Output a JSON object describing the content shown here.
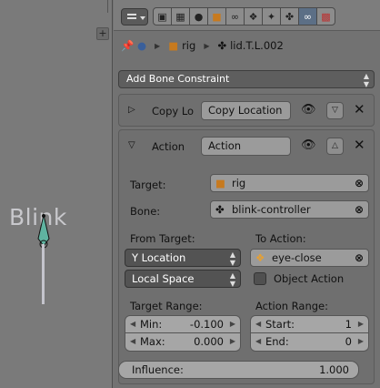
{
  "viewport": {
    "bone_name": "Blink"
  },
  "header": {
    "tabs": [
      "render-icon",
      "scene-icon",
      "world-icon",
      "object-icon",
      "constraint-icon",
      "modifier-icon",
      "data-icon",
      "bone-icon",
      "bone-constraint-icon",
      "texture-icon"
    ],
    "active_tab": "bone-constraint-icon"
  },
  "breadcrumb": {
    "object": "rig",
    "bone": "lid.T.L.002"
  },
  "add_constraint": {
    "label": "Add Bone Constraint"
  },
  "constraints": [
    {
      "type": "Copy Lo",
      "name": "Copy Location",
      "collapsed": true
    },
    {
      "type": "Action",
      "name": "Action",
      "collapsed": false,
      "target_label": "Target:",
      "target": "rig",
      "bone_label": "Bone:",
      "bone": "blink-controller",
      "from_target_label": "From Target:",
      "from_target": "Y Location",
      "space": "Local Space",
      "to_action_label": "To Action:",
      "to_action": "eye-close",
      "object_action_label": "Object Action",
      "target_range_label": "Target Range:",
      "min_label": "Min:",
      "min_value": "-0.100",
      "max_label": "Max:",
      "max_value": "0.000",
      "action_range_label": "Action Range:",
      "start_label": "Start:",
      "start_value": "1",
      "end_label": "End:",
      "end_value": "0",
      "influence_label": "Influence:",
      "influence_value": "1.000"
    }
  ],
  "colors": {
    "active_tab": "#5c6f86",
    "bone_head": "#5fb3a0"
  }
}
